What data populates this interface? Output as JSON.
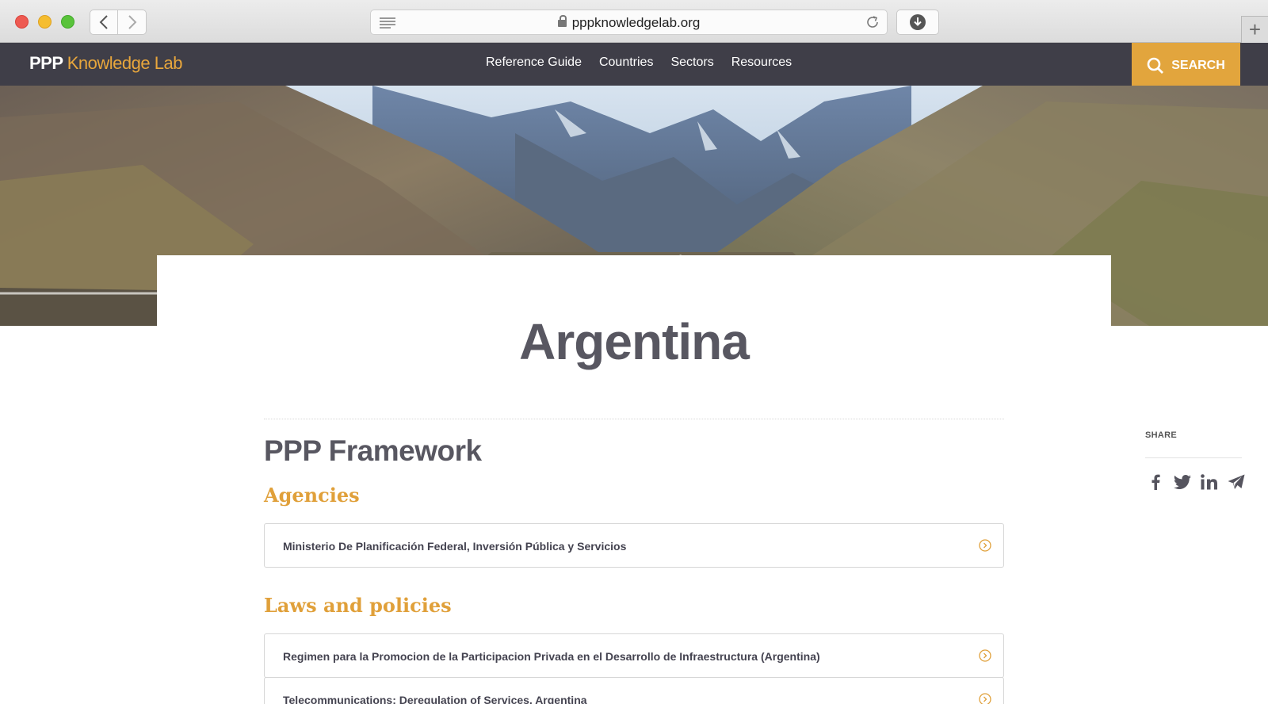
{
  "browser": {
    "url": "pppknowledgelab.org",
    "new_tab": "+"
  },
  "header": {
    "logo_primary": "PPP",
    "logo_secondary": "Knowledge Lab",
    "nav": [
      "Reference Guide",
      "Countries",
      "Sectors",
      "Resources"
    ],
    "search_label": "SEARCH"
  },
  "page": {
    "title": "Argentina",
    "section_title": "PPP Framework",
    "agencies": {
      "heading": "Agencies",
      "items": [
        "Ministerio De Planificación Federal, Inversión Pública y Servicios"
      ]
    },
    "laws": {
      "heading": "Laws and policies",
      "items": [
        "Regimen para la Promocion de la Participacion Privada en el Desarrollo de Infraestructura (Argentina)",
        "Telecommunications: Deregulation of Services, Argentina"
      ]
    }
  },
  "share": {
    "label": "SHARE",
    "icons": [
      "facebook-icon",
      "twitter-icon",
      "linkedin-icon",
      "send-icon"
    ]
  },
  "colors": {
    "accent": "#e2a53d",
    "header_bg": "#3f3e48",
    "title_text": "#585761"
  }
}
